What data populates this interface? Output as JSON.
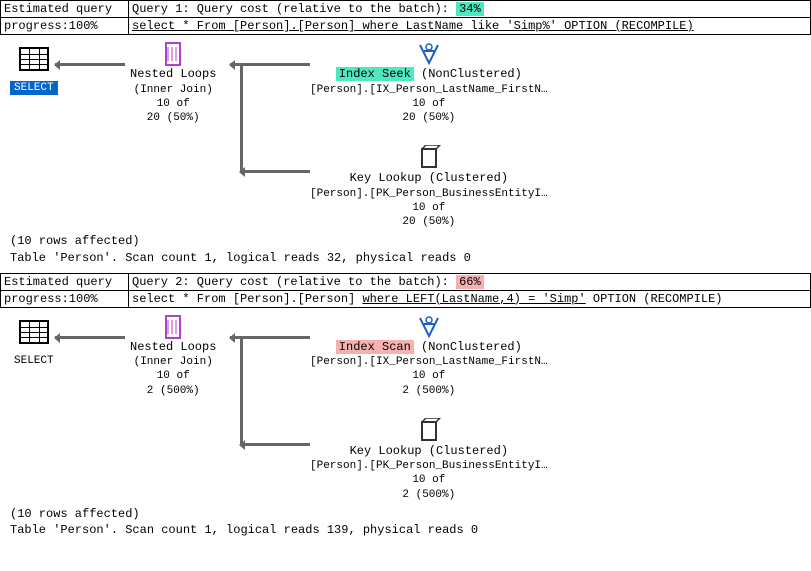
{
  "queries": [
    {
      "progress_label": "Estimated query",
      "progress_value": "progress:100%",
      "header_text": "Query 1: Query cost (relative to the batch): ",
      "cost_value": "34%",
      "sql": "select * From [Person].[Person] where LastName like 'Simp%' OPTION (RECOMPILE)",
      "select_label": "SELECT",
      "nested_loops": {
        "title": "Nested Loops",
        "subtitle": "(Inner Join)",
        "rows": "10 of",
        "pct": "20 (50%)"
      },
      "index_op": {
        "label": "Index Seek",
        "type": "(NonClustered)",
        "obj": "[Person].[IX_Person_LastName_FirstN…",
        "rows": "10 of",
        "pct": "20 (50%)"
      },
      "key_lookup": {
        "title": "Key Lookup (Clustered)",
        "obj": "[Person].[PK_Person_BusinessEntityI…",
        "rows": "10 of",
        "pct": "20 (50%)"
      },
      "results_line1": "(10 rows affected)",
      "results_line2": "Table 'Person'. Scan count 1, logical reads 32, physical reads 0"
    },
    {
      "progress_label": "Estimated query",
      "progress_value": "progress:100%",
      "header_text": "Query 2: Query cost (relative to the batch): ",
      "cost_value": "66%",
      "sql_pre": "select * From [Person].[Person] ",
      "sql_mid": "where LEFT(LastName,4) = 'Simp'",
      "sql_post": " OPTION (RECOMPILE)",
      "select_label": "SELECT",
      "nested_loops": {
        "title": "Nested Loops",
        "subtitle": "(Inner Join)",
        "rows": "10 of",
        "pct": "2 (500%)"
      },
      "index_op": {
        "label": "Index Scan",
        "type": "(NonClustered)",
        "obj": "[Person].[IX_Person_LastName_FirstN…",
        "rows": "10 of",
        "pct": "2 (500%)"
      },
      "key_lookup": {
        "title": "Key Lookup (Clustered)",
        "obj": "[Person].[PK_Person_BusinessEntityI…",
        "rows": "10 of",
        "pct": "2 (500%)"
      },
      "results_line1": "(10 rows affected)",
      "results_line2": "Table 'Person'. Scan count 1, logical reads 139, physical reads 0"
    }
  ]
}
